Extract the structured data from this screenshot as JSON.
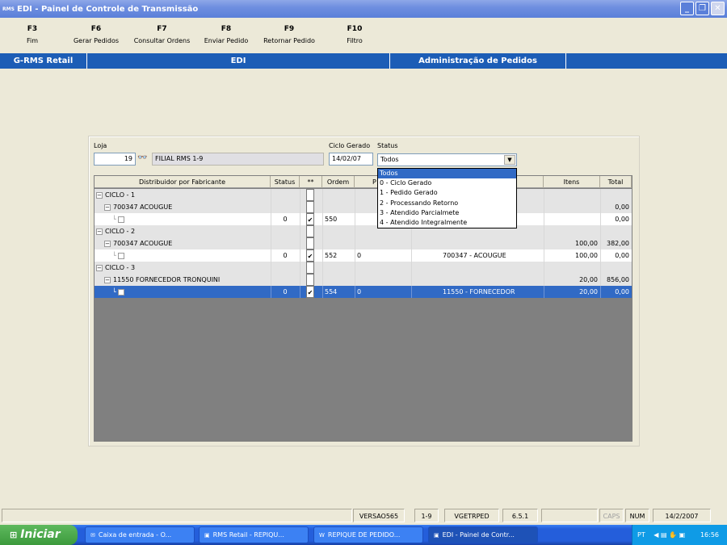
{
  "window": {
    "app_icon": "RMS",
    "title": "EDI - Painel de Controle de Transmissão"
  },
  "fkeys": [
    {
      "key": "F3",
      "label": "Fim"
    },
    {
      "key": "F6",
      "label": "Gerar Pedidos"
    },
    {
      "key": "F7",
      "label": "Consultar Ordens"
    },
    {
      "key": "F8",
      "label": "Enviar Pedido"
    },
    {
      "key": "F9",
      "label": "Retornar Pedido"
    },
    {
      "key": "F10",
      "label": "Filtro"
    }
  ],
  "navbar": {
    "left": "G-RMS Retail",
    "mid": "EDI",
    "right": "Administração de Pedidos"
  },
  "filters": {
    "loja_label": "Loja",
    "loja_value": "19",
    "loja_name": "FILIAL RMS 1-9",
    "ciclo_label": "Ciclo Gerado",
    "ciclo_value": "14/02/07",
    "status_label": "Status",
    "status_value": "Todos",
    "status_options": [
      "Todos",
      "0 - Ciclo Gerado",
      "1 - Pedido Gerado",
      "2 - Processando Retorno",
      "3 - Atendido Parcialmete",
      "4 - Atendido Integralmente"
    ]
  },
  "grid": {
    "headers": {
      "distribuidor": "Distribuidor por Fabricante",
      "status": "Status",
      "flag": "**",
      "ordem": "Ordem",
      "p": "P",
      "itens": "Itens",
      "total": "Total"
    },
    "rows": [
      {
        "indent": 0,
        "toggle": "−",
        "name": "CICLO - 1",
        "status": "",
        "checked": false,
        "ordem": "",
        "p": "",
        "dest": "",
        "itens": "",
        "total": "",
        "type": "grp"
      },
      {
        "indent": 1,
        "toggle": "−",
        "name": "700347 ACOUGUE",
        "status": "",
        "checked": false,
        "ordem": "",
        "p": "",
        "dest": "",
        "itens": "",
        "total": "0,00",
        "type": "grp"
      },
      {
        "indent": 2,
        "toggle": "",
        "name": "",
        "status": "0",
        "checked": true,
        "ordem": "550",
        "p": "",
        "dest": "",
        "itens": "",
        "total": "0,00",
        "type": "leaf"
      },
      {
        "indent": 0,
        "toggle": "−",
        "name": "CICLO - 2",
        "status": "",
        "checked": false,
        "ordem": "",
        "p": "",
        "dest": "",
        "itens": "",
        "total": "",
        "type": "grp"
      },
      {
        "indent": 1,
        "toggle": "−",
        "name": "700347 ACOUGUE",
        "status": "",
        "checked": false,
        "ordem": "",
        "p": "",
        "dest": "",
        "itens": "100,00",
        "total": "382,00",
        "type": "grp"
      },
      {
        "indent": 2,
        "toggle": "",
        "name": "",
        "status": "0",
        "checked": true,
        "ordem": "552",
        "p": "0",
        "dest": "700347 - ACOUGUE",
        "itens": "100,00",
        "total": "0,00",
        "type": "leaf"
      },
      {
        "indent": 0,
        "toggle": "−",
        "name": "CICLO - 3",
        "status": "",
        "checked": false,
        "ordem": "",
        "p": "",
        "dest": "",
        "itens": "",
        "total": "",
        "type": "grp"
      },
      {
        "indent": 1,
        "toggle": "−",
        "name": "11550 FORNECEDOR TRONQUINI",
        "status": "",
        "checked": false,
        "ordem": "",
        "p": "",
        "dest": "",
        "itens": "20,00",
        "total": "856,00",
        "type": "grp"
      },
      {
        "indent": 2,
        "toggle": "",
        "name": "",
        "status": "0",
        "checked": true,
        "ordem": "554",
        "p": "0",
        "dest": "11550 - FORNECEDOR",
        "itens": "20,00",
        "total": "0,00",
        "type": "selected"
      }
    ]
  },
  "statusbar": {
    "versao": "VERSAO565",
    "filial": "1-9",
    "prog": "VGETRPED",
    "ver": "6.5.1",
    "caps": "CAPS",
    "num": "NUM",
    "date": "14/2/2007"
  },
  "taskbar": {
    "start": "Iniciar",
    "tasks": [
      "Caixa de entrada - O...",
      "RMS Retail - REPIQU...",
      "REPIQUE DE PEDIDO...",
      "EDI - Painel de Contr..."
    ],
    "lang": "PT",
    "clock": "16:56"
  }
}
